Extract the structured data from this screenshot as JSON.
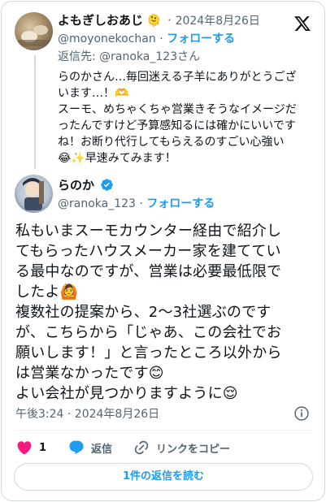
{
  "reply_tweet": {
    "display_name": "よもぎしおあじ",
    "name_emoji": "🫠",
    "dot": "·",
    "date": "2024年8月26日",
    "handle": "@moyonekochan",
    "follow_label": "フォローする",
    "reply_to": "返信先: @ranoka_123さん",
    "text_lines": [
      "らのかさん…毎回迷える子羊にありがとうござ",
      "います…！🫶",
      "スーモ、めちゃくちゃ営業きそうなイメージだ",
      "ったんですけど予算感知るには確かにいいです",
      "ね！お断り代行してもらえるのすごい心強い",
      "😂✨早速みてみます！"
    ]
  },
  "main_tweet": {
    "display_name": "らのか",
    "handle": "@ranoka_123",
    "dot": "·",
    "follow_label": "フォローする",
    "text_lines": [
      "私もいまスーモカウンター経由で紹介し",
      "てもらったハウスメーカー家を建ててい",
      "る最中なのですが、営業は必要最低限で",
      "したよ🙆",
      "複数社の提案から、2〜3社選ぶのです",
      "が、こちらから「じゃあ、この会社でお",
      "願いします！」と言ったところ以外から",
      "は営業なかったです😊",
      "よい会社が見つかりますように😌"
    ],
    "timestamp": "午後3:24 · 2024年8月26日",
    "like_count": "1",
    "reply_label": "返信",
    "copy_link_label": "リンクをコピー",
    "read_replies_label": "1件の返信を読む"
  },
  "colors": {
    "accent": "#1d9bf0",
    "like": "#f91880",
    "muted": "#536471",
    "border": "#cfd9de"
  },
  "icons": [
    "x-logo-icon",
    "verified-badge-icon",
    "info-icon",
    "heart-icon",
    "reply-bubble-icon",
    "link-icon"
  ]
}
